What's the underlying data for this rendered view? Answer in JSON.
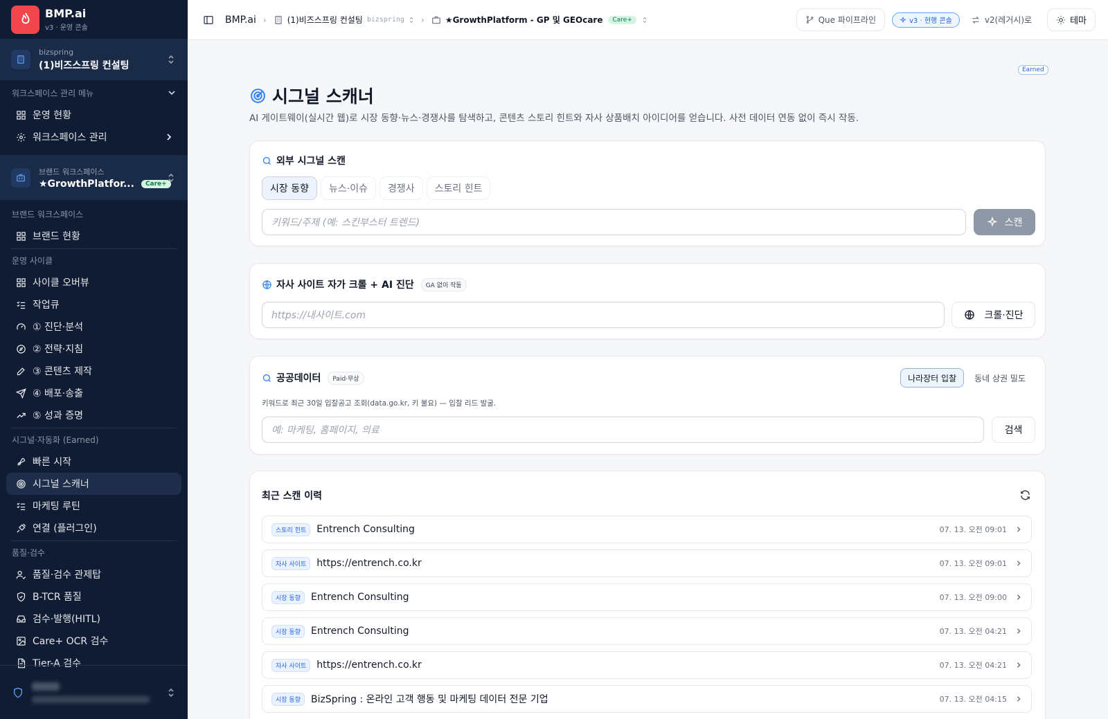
{
  "sidebar": {
    "brand": {
      "title": "BMP.ai",
      "subtitle": "v3 · 운영 콘솔"
    },
    "workspace": {
      "sub": "bizspring",
      "name": "(1)비즈스프링 컨설팅"
    },
    "mgmt_section": "워크스페이스 관리 메뉴",
    "mgmt_items": [
      {
        "label": "운영 현황",
        "icon": "grid-icon"
      },
      {
        "label": "워크스페이스 관리",
        "icon": "gear-icon"
      }
    ],
    "brand_ws": {
      "sub": "브랜드 워크스페이스",
      "name": "★GrowthPlatfor...",
      "badge": "Care+"
    },
    "brand_section": "브랜드 워크스페이스",
    "brand_items": [
      {
        "label": "브랜드 현황",
        "icon": "grid-icon"
      }
    ],
    "ops_section": "운영 사이클",
    "ops_items": [
      {
        "label": "사이클 오버뷰",
        "icon": "grid-icon"
      },
      {
        "label": "작업큐",
        "icon": "list-check-icon"
      },
      {
        "label": "① 진단·분석",
        "icon": "gauge-icon"
      },
      {
        "label": "② 전략·지침",
        "icon": "compass-icon"
      },
      {
        "label": "③ 콘텐츠 제작",
        "icon": "pen-icon"
      },
      {
        "label": "④ 배포·송출",
        "icon": "send-icon"
      },
      {
        "label": "⑤ 성과 증명",
        "icon": "trend-icon"
      }
    ],
    "signal_section": "시그널·자동화 (Earned)",
    "signal_items": [
      {
        "label": "빠른 시작",
        "icon": "rocket-icon"
      },
      {
        "label": "시그널 스캐너",
        "icon": "radar-icon"
      },
      {
        "label": "마케팅 루틴",
        "icon": "list-check-icon"
      },
      {
        "label": "연결 (플러그인)",
        "icon": "plug-icon"
      }
    ],
    "qa_section": "품질·검수",
    "qa_items": [
      {
        "label": "품질·검수 관제탑",
        "icon": "user-check-icon"
      },
      {
        "label": "B-TCR 품질",
        "icon": "shield-icon"
      },
      {
        "label": "검수·발행(HITL)",
        "icon": "inbox-icon"
      },
      {
        "label": "Care+ OCR 검수",
        "icon": "image-icon"
      },
      {
        "label": "Tier-A 검수",
        "icon": "file-icon"
      }
    ]
  },
  "topbar": {
    "crumb_root": "BMP.ai",
    "crumb_org": "(1)비즈스프링 컨설팅",
    "crumb_org_slug": "bizspring",
    "crumb_brand": "★GrowthPlatform - GP 및 GEOcare",
    "crumb_brand_badge": "Care+",
    "pipeline_btn": "Que 파이프라인",
    "version_pill": "v3 · 현행 콘솔",
    "legacy_btn": "v2(레거시)로",
    "theme_btn": "테마"
  },
  "page": {
    "earned_tag": "Earned",
    "title": "시그널 스캐너",
    "description": "AI 게이트웨이(실시간 웹)로 시장 동향·뉴스·경쟁사를 탐색하고, 콘텐츠 스토리 힌트와 자사 상품배치 아이디어를 얻습니다. 사전 데이터 연동 없이 즉시 작동."
  },
  "external_scan": {
    "title": "외부 시그널 스캔",
    "tabs": [
      "시장 동향",
      "뉴스·이슈",
      "경쟁사",
      "스토리 힌트"
    ],
    "placeholder": "키워드/주제 (예: 스킨부스터 트렌드)",
    "scan_label": "스캔"
  },
  "site_crawl": {
    "title": "자사 사이트 자가 크롤 + AI 진단",
    "badge": "GA 없이 작동",
    "placeholder": "https://내사이트.com",
    "button": "크롤·진단"
  },
  "public_data": {
    "title": "공공데이터",
    "badge": "Paid·무상",
    "toggles": [
      "나라장터 입찰",
      "동네 상권 밀도"
    ],
    "helper": "키워드로 최근 30일 입찰공고 조회(data.go.kr, 키 불요) — 입찰 리드 발굴.",
    "placeholder": "예: 마케팅, 홈페이지, 의료",
    "button": "검색"
  },
  "history": {
    "title": "최근 스캔 이력",
    "rows": [
      {
        "badge": "스토리 힌트",
        "title": "Entrench Consulting",
        "time": "07. 13. 오전 09:01"
      },
      {
        "badge": "자사 사이트",
        "title": "https://entrench.co.kr",
        "time": "07. 13. 오전 09:01"
      },
      {
        "badge": "시장 동향",
        "title": "Entrench Consulting",
        "time": "07. 13. 오전 09:00"
      },
      {
        "badge": "시장 동향",
        "title": "Entrench Consulting",
        "time": "07. 13. 오전 04:21"
      },
      {
        "badge": "자사 사이트",
        "title": "https://entrench.co.kr",
        "time": "07. 13. 오전 04:21"
      },
      {
        "badge": "시장 동향",
        "title": "BizSpring : 온라인 고객 행동 및 마케팅 데이터 전문 기업",
        "time": "07. 13. 오전 04:15"
      }
    ]
  },
  "colors": {
    "sidebar_bg": "#0f1c33",
    "logo": "#f0464c",
    "accent": "#2563eb"
  }
}
